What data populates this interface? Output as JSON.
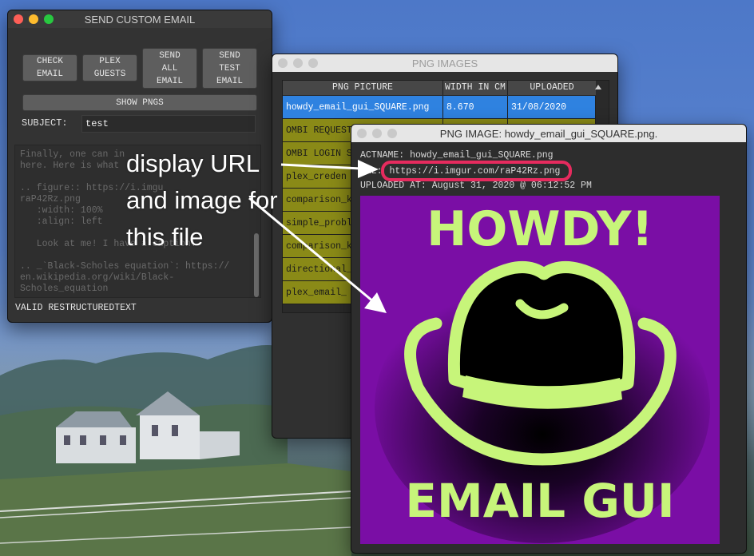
{
  "email_window": {
    "title": "SEND CUSTOM EMAIL",
    "buttons": {
      "check_email": "CHECK\nEMAIL",
      "plex_guests": "PLEX\nGUESTS",
      "send_all": "SEND\nALL\nEMAIL",
      "send_test": "SEND\nTEST\nEMAIL",
      "show_pngs": "SHOW PNGS"
    },
    "subject_label": "SUBJECT:",
    "subject_value": "test",
    "body_lines": [
      "Finally, one can in",
      "here. Here is what",
      "",
      ".. figure:: https://i.imgu",
      "raP42Rz.png",
      "   :width: 100%",
      "   :align: left",
      "",
      "   Look at me! I have a caption.",
      "",
      ".. _`Black-Scholes equation`: https://",
      "en.wikipedia.org/wiki/Black-",
      "Scholes_equation"
    ],
    "status": "VALID RESTRUCTUREDTEXT"
  },
  "png_window": {
    "title": "PNG IMAGES",
    "columns": [
      "PNG PICTURE",
      "WIDTH IN CM",
      "UPLOADED"
    ],
    "rows": [
      [
        "howdy_email_gui_SQUARE.png",
        "8.670",
        "31/08/2020"
      ],
      [
        "OMBI REQUEST",
        "",
        ""
      ],
      [
        "OMBI LOGIN S",
        "",
        ""
      ],
      [
        "plex_creden",
        "",
        ""
      ],
      [
        "comparison_k",
        "",
        ""
      ],
      [
        "simple_probl",
        "",
        ""
      ],
      [
        "comparison_k",
        "",
        ""
      ],
      [
        "directional_",
        "",
        ""
      ],
      [
        "plex_email_",
        "",
        ""
      ]
    ]
  },
  "image_window": {
    "title": "PNG IMAGE: howdy_email_gui_SQUARE.png.",
    "actname": "ACTNAME: howdy_email_gui_SQUARE.png",
    "url_prefix": "URL: ",
    "url": "https://i.imgur.com/raP42Rz.png",
    "uploaded": "UPLOADED AT: August 31, 2020 @ 06:12:52 PM",
    "image_top_text": "HOWDY!",
    "image_bottom_text": "EMAIL GUI"
  },
  "annotation": {
    "lines": [
      "display URL",
      "and image for",
      "this file"
    ]
  },
  "colors": {
    "highlight": "#e62b5e",
    "image_bg": "#7a0ea5",
    "image_accent": "#c7f57a",
    "row_olive": "#8a8a17",
    "row_selected": "#2f82e0"
  }
}
